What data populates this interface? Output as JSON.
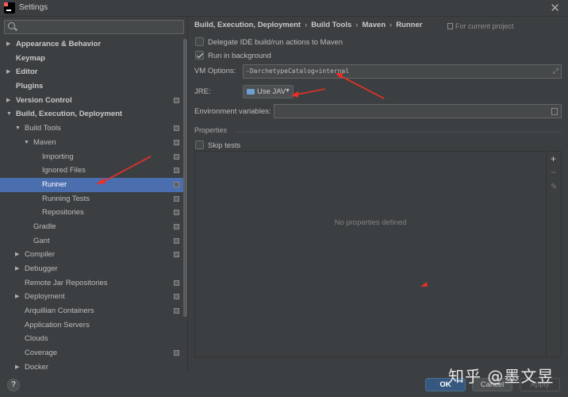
{
  "window": {
    "title": "Settings"
  },
  "search": {
    "placeholder": ""
  },
  "tree": [
    {
      "label": "Appearance & Behavior",
      "bold": true,
      "arrow": "right",
      "indent": 0,
      "proj": false
    },
    {
      "label": "Keymap",
      "bold": true,
      "arrow": "",
      "indent": 0,
      "proj": false
    },
    {
      "label": "Editor",
      "bold": true,
      "arrow": "right",
      "indent": 0,
      "proj": false
    },
    {
      "label": "Plugins",
      "bold": true,
      "arrow": "",
      "indent": 0,
      "proj": false
    },
    {
      "label": "Version Control",
      "bold": true,
      "arrow": "right",
      "indent": 0,
      "proj": true
    },
    {
      "label": "Build, Execution, Deployment",
      "bold": true,
      "arrow": "down",
      "indent": 0,
      "proj": false
    },
    {
      "label": "Build Tools",
      "bold": false,
      "arrow": "down",
      "indent": 1,
      "proj": true
    },
    {
      "label": "Maven",
      "bold": false,
      "arrow": "down",
      "indent": 2,
      "proj": true
    },
    {
      "label": "Importing",
      "bold": false,
      "arrow": "",
      "indent": 3,
      "proj": true
    },
    {
      "label": "Ignored Files",
      "bold": false,
      "arrow": "",
      "indent": 3,
      "proj": true
    },
    {
      "label": "Runner",
      "bold": false,
      "arrow": "",
      "indent": 3,
      "proj": true,
      "selected": true
    },
    {
      "label": "Running Tests",
      "bold": false,
      "arrow": "",
      "indent": 3,
      "proj": true
    },
    {
      "label": "Repositories",
      "bold": false,
      "arrow": "",
      "indent": 3,
      "proj": true
    },
    {
      "label": "Gradle",
      "bold": false,
      "arrow": "",
      "indent": 2,
      "proj": true
    },
    {
      "label": "Gant",
      "bold": false,
      "arrow": "",
      "indent": 2,
      "proj": true
    },
    {
      "label": "Compiler",
      "bold": false,
      "arrow": "right",
      "indent": 1,
      "proj": true
    },
    {
      "label": "Debugger",
      "bold": false,
      "arrow": "right",
      "indent": 1,
      "proj": false
    },
    {
      "label": "Remote Jar Repositories",
      "bold": false,
      "arrow": "",
      "indent": 1,
      "proj": true
    },
    {
      "label": "Deployment",
      "bold": false,
      "arrow": "right",
      "indent": 1,
      "proj": true
    },
    {
      "label": "Arquillian Containers",
      "bold": false,
      "arrow": "",
      "indent": 1,
      "proj": true
    },
    {
      "label": "Application Servers",
      "bold": false,
      "arrow": "",
      "indent": 1,
      "proj": false
    },
    {
      "label": "Clouds",
      "bold": false,
      "arrow": "",
      "indent": 1,
      "proj": false
    },
    {
      "label": "Coverage",
      "bold": false,
      "arrow": "",
      "indent": 1,
      "proj": true
    },
    {
      "label": "Docker",
      "bold": false,
      "arrow": "right",
      "indent": 1,
      "proj": false
    }
  ],
  "breadcrumb": {
    "items": [
      "Build, Execution, Deployment",
      "Build Tools",
      "Maven",
      "Runner"
    ],
    "separator": "›",
    "for_current_project": "For current project"
  },
  "runner": {
    "delegate_label": "Delegate IDE build/run actions to Maven",
    "delegate_checked": false,
    "background_label": "Run in background",
    "background_checked": true,
    "vm_options_label": "VM Options:",
    "vm_options_value": "-DarchetypeCatalog=internal",
    "jre_label": "JRE:",
    "jre_value": "Use JAV",
    "env_label": "Environment variables:",
    "env_value": ""
  },
  "properties": {
    "section_title": "Properties",
    "skip_tests_label": "Skip tests",
    "skip_tests_checked": false,
    "empty_text": "No properties defined"
  },
  "buttons": {
    "ok": "OK",
    "cancel": "Cancel",
    "apply": "Apply",
    "help": "?"
  },
  "watermark": "知乎 @墨文昱",
  "colors": {
    "background": "#3c3f41",
    "selection": "#4b6eaf",
    "annotation_arrow": "#e8302a",
    "ok_button": "#365880"
  }
}
